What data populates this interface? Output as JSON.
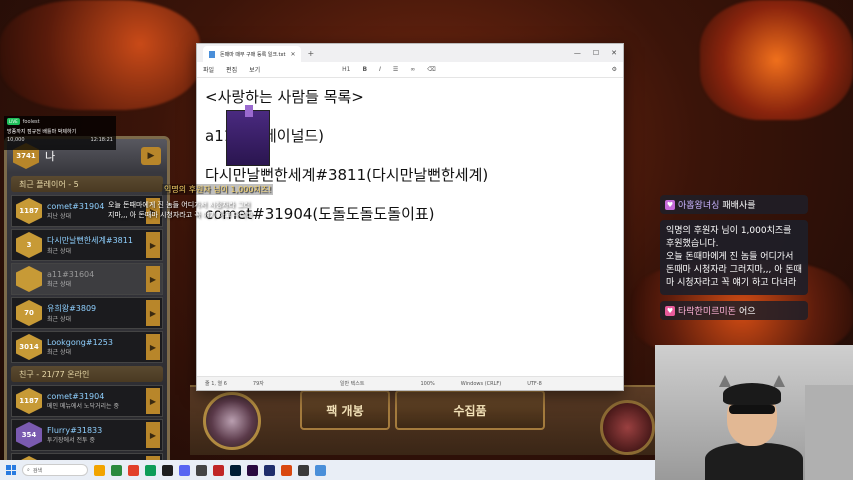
{
  "notepad": {
    "tab_title": "돈때마 때무 구매 등록 일크.txt",
    "menu": [
      "파일",
      "편집",
      "보기"
    ],
    "heading_style": "H1",
    "lines": [
      "<사랑하는 사람들 목록>",
      "a11 04(레이널드)",
      "다시만날뻔한세계#3811(다시만날뻔한세계)",
      "comet#31904(도돌도돌도돌이표)"
    ],
    "status": {
      "position": "줄 1, 열 6",
      "chars": "79자",
      "format": "일반 텍스트",
      "zoom": "100%",
      "line_ending": "Windows (CRLF)",
      "encoding": "UTF-8"
    }
  },
  "stream_overlay": {
    "live_badge": "LIVE",
    "channel": "foolest",
    "title": "방종까지 점규전 배틀마 박제하기",
    "viewers": "10,000",
    "time": "12:18:21"
  },
  "friend_panel": {
    "header_rank": "3741",
    "header_name": "나",
    "recent_section": "최근 플레이어 - 5",
    "recent": [
      {
        "rank": "1187",
        "nick": "comet#31904",
        "status": "지난 상대",
        "dim": false,
        "purple": false
      },
      {
        "rank": "3",
        "nick": "다시만날뻔한세계#3811",
        "status": "최근 상대",
        "dim": false,
        "purple": false
      },
      {
        "rank": "",
        "nick": "a11#31604",
        "status": "최근 상대",
        "dim": true,
        "purple": false
      },
      {
        "rank": "70",
        "nick": "유희왕#3809",
        "status": "최근 상대",
        "dim": false,
        "purple": false
      },
      {
        "rank": "3014",
        "nick": "Lookgong#1253",
        "status": "최근 상대",
        "dim": false,
        "purple": false
      }
    ],
    "friends_section": "친구 - 21/77 온라인",
    "friends": [
      {
        "rank": "1187",
        "nick": "comet#31904",
        "status": "메인 메뉴에서 노닥거리는 중",
        "dim": false,
        "purple": false
      },
      {
        "rank": "354",
        "nick": "Flurry#31833",
        "status": "투기장에서 전투 중",
        "dim": false,
        "purple": true
      },
      {
        "rank": "",
        "nick": "Helve187#31643",
        "status": "",
        "dim": false,
        "purple": false
      }
    ]
  },
  "donation": {
    "title": "익명의 후원자 님이 1,000치즈!",
    "line1": "오늘 돈때마에게 진 놈들 어디가서 시청자라 그러",
    "line2": "지마,,, 아 돈때마 시청자라고 꼭 얘기 하고 다녀라"
  },
  "chat": {
    "top_user": "아홉왕녀싱",
    "top_text": "패배사를",
    "bubble": "익명의 후원자 님이 1,000치즈를 후원했습니다.\n오늘 돈때마에게 진 놈들 어디가서 돈때마 시청자라 그러지마,,, 아 돈때마 시청자라고 꼭 얘기 하고 다녀라",
    "bottom_user": "타락한미르미돈",
    "bottom_text": "어으"
  },
  "game": {
    "pack_button": "팩 개봉",
    "craft_button": "수집품"
  },
  "taskbar": {
    "search_placeholder": "검색"
  }
}
